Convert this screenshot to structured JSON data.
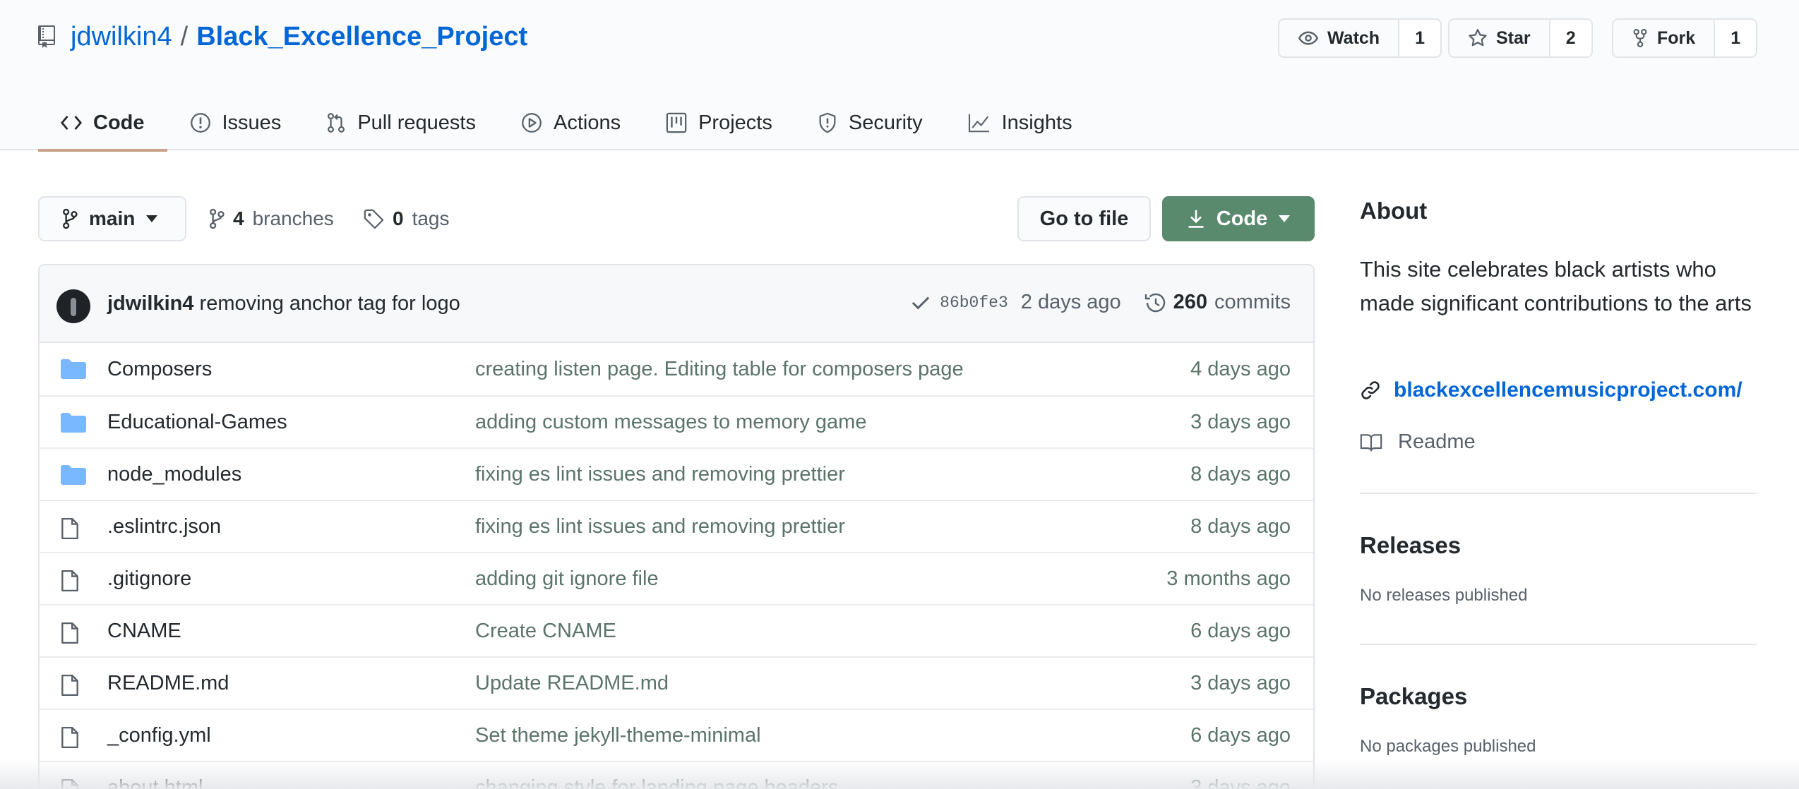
{
  "repo": {
    "owner": "jdwilkin4",
    "separator": "/",
    "name": "Black_Excellence_Project"
  },
  "social": {
    "watch": {
      "label": "Watch",
      "count": "1"
    },
    "star": {
      "label": "Star",
      "count": "2"
    },
    "fork": {
      "label": "Fork",
      "count": "1"
    }
  },
  "tabs": [
    {
      "label": "Code",
      "icon": "code-icon",
      "active": true
    },
    {
      "label": "Issues",
      "icon": "issue-icon"
    },
    {
      "label": "Pull requests",
      "icon": "pull-request-icon"
    },
    {
      "label": "Actions",
      "icon": "play-icon"
    },
    {
      "label": "Projects",
      "icon": "project-icon"
    },
    {
      "label": "Security",
      "icon": "shield-icon"
    },
    {
      "label": "Insights",
      "icon": "graph-icon"
    }
  ],
  "nav": {
    "branch": "main",
    "branches_count": "4",
    "branches_label": "branches",
    "tags_count": "0",
    "tags_label": "tags",
    "goto_file": "Go to file",
    "code_button": "Code"
  },
  "latest_commit": {
    "author": "jdwilkin4",
    "message": "removing anchor tag for logo",
    "sha": "86b0fe3",
    "age": "2 days ago",
    "commits_count": "260",
    "commits_label": "commits",
    "status_color": "#586069"
  },
  "files": [
    {
      "type": "dir",
      "name": "Composers",
      "message": "creating listen page. Editing table for composers page",
      "age": "4 days ago"
    },
    {
      "type": "dir",
      "name": "Educational-Games",
      "message": "adding custom messages to memory game",
      "age": "3 days ago"
    },
    {
      "type": "dir",
      "name": "node_modules",
      "message": "fixing es lint issues and removing prettier",
      "age": "8 days ago"
    },
    {
      "type": "file",
      "name": ".eslintrc.json",
      "message": "fixing es lint issues and removing prettier",
      "age": "8 days ago"
    },
    {
      "type": "file",
      "name": ".gitignore",
      "message": "adding git ignore file",
      "age": "3 months ago"
    },
    {
      "type": "file",
      "name": "CNAME",
      "message": "Create CNAME",
      "age": "6 days ago"
    },
    {
      "type": "file",
      "name": "README.md",
      "message": "Update README.md",
      "age": "3 days ago"
    },
    {
      "type": "file",
      "name": "_config.yml",
      "message": "Set theme jekyll-theme-minimal",
      "age": "6 days ago"
    },
    {
      "type": "file",
      "name": "about.html",
      "message": "changing style for landing page headers",
      "age": "3 days ago"
    }
  ],
  "sidebar": {
    "about_heading": "About",
    "description": "This site celebrates black artists who made significant contributions to the arts",
    "website": "blackexcellencemusicproject.com/",
    "readme": "Readme",
    "releases_heading": "Releases",
    "releases_note": "No releases published",
    "packages_heading": "Packages",
    "packages_note": "No packages published"
  },
  "colors": {
    "link": "#0366d6",
    "code_button_bg": "#5a8a6e",
    "folder_icon": "#79b8ff",
    "active_tab_underline": "#c9a48a"
  }
}
